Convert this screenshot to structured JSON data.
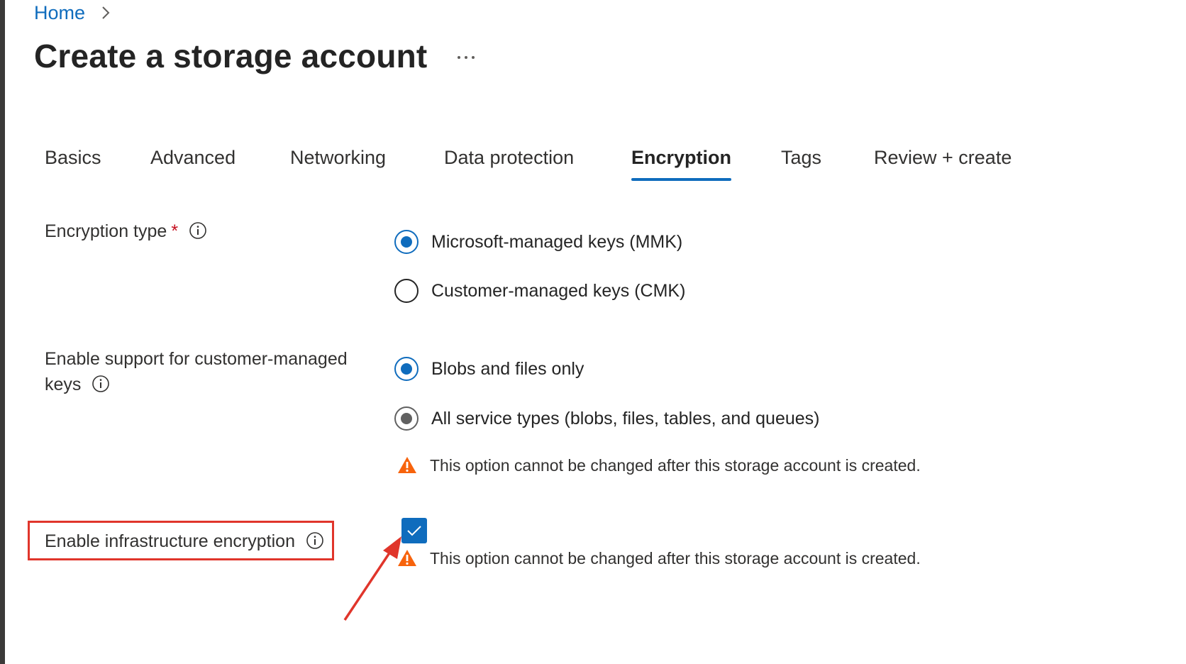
{
  "breadcrumb": {
    "home": "Home"
  },
  "page": {
    "title": "Create a storage account",
    "more_label": "..."
  },
  "tabs": [
    {
      "label": "Basics",
      "active": false
    },
    {
      "label": "Advanced",
      "active": false
    },
    {
      "label": "Networking",
      "active": false
    },
    {
      "label": "Data protection",
      "active": false
    },
    {
      "label": "Encryption",
      "active": true
    },
    {
      "label": "Tags",
      "active": false
    },
    {
      "label": "Review + create",
      "active": false
    }
  ],
  "form": {
    "encryption_type": {
      "label": "Encryption type",
      "required_mark": "*",
      "options": [
        {
          "label": "Microsoft-managed keys (MMK)",
          "selected": true
        },
        {
          "label": "Customer-managed keys (CMK)",
          "selected": false
        }
      ]
    },
    "cmk_support": {
      "label_line1": "Enable support for customer-managed",
      "label_line2": "keys",
      "options": [
        {
          "label": "Blobs and files only",
          "selected": true
        },
        {
          "label": "All service types (blobs, files, tables, and queues)",
          "selected": false,
          "disabled": true
        }
      ],
      "warning": "This option cannot be changed after this storage account is created."
    },
    "infrastructure_encryption": {
      "label": "Enable infrastructure encryption",
      "checked": true,
      "warning": "This option cannot be changed after this storage account is created."
    }
  },
  "colors": {
    "accent": "#0f6cbd",
    "warning": "#f7630c",
    "annotation": "#e0352b",
    "required": "#c50f1f"
  },
  "icons": {
    "chevron": "chevron-right-icon",
    "info": "info-icon",
    "warning": "warning-icon",
    "check": "checkmark-icon",
    "more": "more-icon"
  }
}
